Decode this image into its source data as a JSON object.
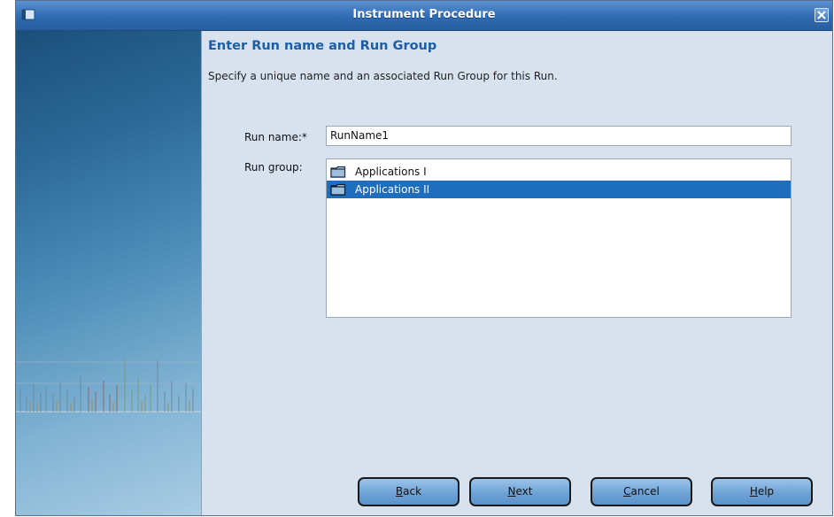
{
  "window": {
    "title": "Instrument Procedure"
  },
  "page": {
    "heading": "Enter Run name and Run Group",
    "subtitle": "Specify a unique name and an associated Run Group for this Run."
  },
  "form": {
    "run_name_label": "Run name:*",
    "run_name_value": "RunName1",
    "run_group_label": "Run group:",
    "run_groups": [
      {
        "label": "Applications I",
        "selected": false
      },
      {
        "label": "Applications II",
        "selected": true
      }
    ]
  },
  "buttons": {
    "back": {
      "first": "B",
      "rest": "ack"
    },
    "next": {
      "first": "N",
      "rest": "ext"
    },
    "cancel": {
      "first": "C",
      "rest": "ancel"
    },
    "help": {
      "first": "H",
      "rest": "elp"
    }
  },
  "icons": {
    "window_menu": "window-menu-icon",
    "close": "close-icon",
    "folder": "folder-icon"
  },
  "colors": {
    "title_bar": "#2f6bb3",
    "heading": "#1b5fa8",
    "selection": "#1f6dbd",
    "window_bg": "#d7e2ee"
  }
}
